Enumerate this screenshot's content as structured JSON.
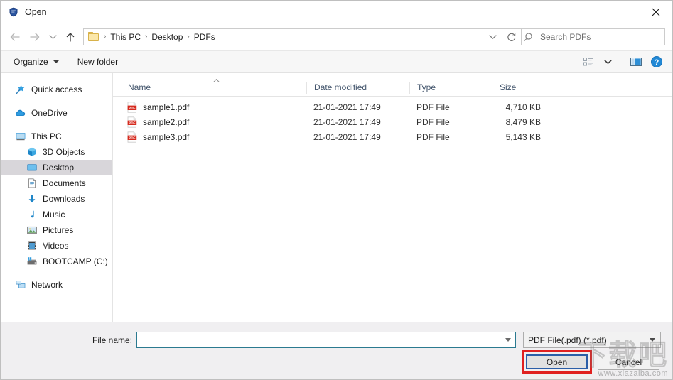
{
  "window": {
    "title": "Open",
    "app_icon": "pdf-app-shield-icon",
    "close_label": "✕"
  },
  "navigation": {
    "back_icon": "arrow-left-icon",
    "forward_icon": "arrow-right-icon",
    "recent_icon": "chevron-down-icon",
    "up_icon": "arrow-up-icon",
    "dropdown_icon": "chevron-down-icon",
    "refresh_icon": "refresh-icon"
  },
  "breadcrumb": {
    "folder_icon": "folder-icon",
    "separator": "›",
    "items": [
      "This PC",
      "Desktop",
      "PDFs"
    ]
  },
  "search": {
    "icon": "search-icon",
    "placeholder": "Search PDFs",
    "value": ""
  },
  "commandbar": {
    "organize_label": "Organize",
    "new_folder_label": "New folder",
    "view_icon": "view-list-icon",
    "view_caret_icon": "chevron-down-icon",
    "preview_icon": "preview-pane-icon",
    "help_icon": "help-icon"
  },
  "sidebar": {
    "items": [
      {
        "label": "Quick access",
        "icon": "star-pin-icon",
        "level": 0,
        "selected": false
      },
      {
        "label": "OneDrive",
        "icon": "cloud-icon",
        "level": 0,
        "selected": false
      },
      {
        "label": "This PC",
        "icon": "monitor-icon",
        "level": 0,
        "selected": false
      },
      {
        "label": "3D Objects",
        "icon": "cube-icon",
        "level": 1,
        "selected": false
      },
      {
        "label": "Desktop",
        "icon": "desktop-icon",
        "level": 1,
        "selected": true
      },
      {
        "label": "Documents",
        "icon": "document-icon",
        "level": 1,
        "selected": false
      },
      {
        "label": "Downloads",
        "icon": "download-arrow-icon",
        "level": 1,
        "selected": false
      },
      {
        "label": "Music",
        "icon": "music-note-icon",
        "level": 1,
        "selected": false
      },
      {
        "label": "Pictures",
        "icon": "picture-icon",
        "level": 1,
        "selected": false
      },
      {
        "label": "Videos",
        "icon": "video-film-icon",
        "level": 1,
        "selected": false
      },
      {
        "label": "BOOTCAMP (C:)",
        "icon": "hard-drive-icon",
        "level": 1,
        "selected": false
      },
      {
        "label": "Network",
        "icon": "network-icon",
        "level": 0,
        "selected": false
      }
    ]
  },
  "filelist": {
    "sort_indicator": "ascending",
    "columns": [
      "Name",
      "Date modified",
      "Type",
      "Size"
    ],
    "rows": [
      {
        "name": "sample1.pdf",
        "date": "21-01-2021 17:49",
        "type": "PDF File",
        "size": "4,710 KB",
        "icon": "pdf-file-icon"
      },
      {
        "name": "sample2.pdf",
        "date": "21-01-2021 17:49",
        "type": "PDF File",
        "size": "8,479 KB",
        "icon": "pdf-file-icon"
      },
      {
        "name": "sample3.pdf",
        "date": "21-01-2021 17:49",
        "type": "PDF File",
        "size": "5,143 KB",
        "icon": "pdf-file-icon"
      }
    ]
  },
  "footer": {
    "filename_label": "File name:",
    "filename_value": "",
    "filetype_value": "PDF File(.pdf) (*.pdf)",
    "open_label": "Open",
    "cancel_label": "Cancel"
  },
  "watermark": {
    "text_cn": "下载吧",
    "url": "www.xiazaiba.com"
  },
  "colors": {
    "accent": "#2b5ea7",
    "highlight_red": "#e02020",
    "focus_border": "#2b7a90",
    "pdf_red": "#d62b1f",
    "folder_yellow": "#fbe7a9",
    "selection_gray": "#d8d6da"
  }
}
